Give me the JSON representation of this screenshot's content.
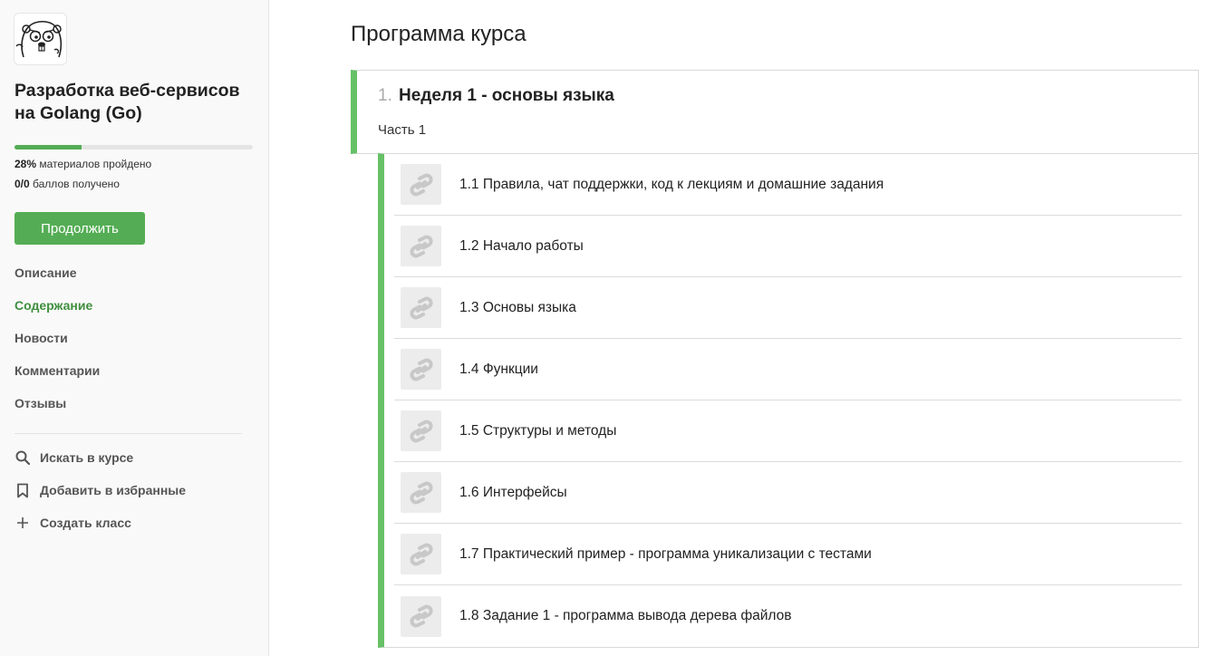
{
  "course": {
    "title_line1": "Разработка веб-сервисов",
    "title_line2": "на Golang (Go)",
    "progress_percent": 28,
    "progress_value": "28%",
    "progress_text": "материалов пройдено",
    "points_value": "0/0",
    "points_text": "баллов получено",
    "continue_label": "Продолжить"
  },
  "nav": {
    "items": [
      {
        "label": "Описание",
        "active": false
      },
      {
        "label": "Содержание",
        "active": true
      },
      {
        "label": "Новости",
        "active": false
      },
      {
        "label": "Комментарии",
        "active": false
      },
      {
        "label": "Отзывы",
        "active": false
      }
    ]
  },
  "tools": {
    "search": {
      "label": "Искать в курсе",
      "icon": "search-icon"
    },
    "bookmark": {
      "label": "Добавить в избранные",
      "icon": "bookmark-icon"
    },
    "create_class": {
      "label": "Создать класс",
      "icon": "plus-icon"
    }
  },
  "main": {
    "page_title": "Программа курса",
    "module": {
      "number": "1.",
      "title": "Неделя 1 - основы языка",
      "subtitle": "Часть 1"
    },
    "lessons": [
      {
        "title": "1.1 Правила, чат поддержки, код к лекциям и домашние задания"
      },
      {
        "title": "1.2 Начало работы"
      },
      {
        "title": "1.3 Основы языка"
      },
      {
        "title": "1.4 Функции"
      },
      {
        "title": "1.5 Структуры и методы"
      },
      {
        "title": "1.6 Интерфейсы"
      },
      {
        "title": "1.7 Практический пример - программа уникализации с тестами"
      },
      {
        "title": "1.8 Задание 1 - программа вывода дерева файлов"
      }
    ]
  },
  "colors": {
    "accent": "#54ad54",
    "active_nav": "#3f8f3f",
    "module_bar": "#66c166"
  }
}
